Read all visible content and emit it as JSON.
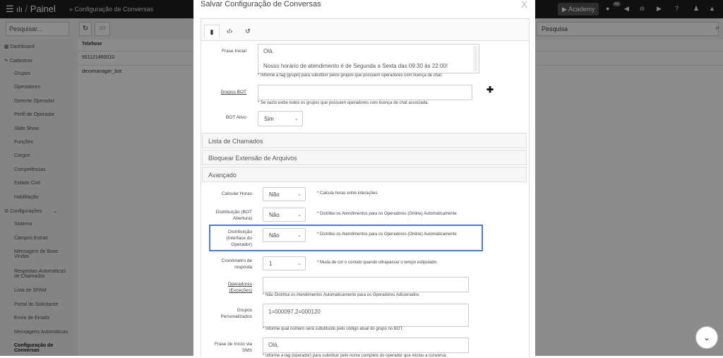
{
  "topbar": {
    "menu_icon": "menu-icon",
    "logo_icon": "bars-logo-icon",
    "separator": "/",
    "app_name": "Painel",
    "breadcrumb": "» Configuração de Conversas",
    "academy_label": "Academy",
    "academy_icon": "youtube-icon",
    "badge": "48"
  },
  "toolbar": {
    "search_placeholder": "Pesquisar...",
    "refresh_icon": "refresh-icon",
    "pager": "2/2",
    "right_search": "Pesquisa"
  },
  "sidebar": {
    "items": [
      {
        "label": "Dashboard"
      },
      {
        "label": "Cadastros"
      },
      {
        "label": "Grupos"
      },
      {
        "label": "Operadores"
      },
      {
        "label": "Gerente Operador"
      },
      {
        "label": "Perfil de Operador"
      },
      {
        "label": "Slide Show"
      },
      {
        "label": "Funções"
      },
      {
        "label": "Cargos"
      },
      {
        "label": "Competências"
      },
      {
        "label": "Estado Civil"
      },
      {
        "label": "Habilitação"
      },
      {
        "label": "Configurações"
      },
      {
        "label": "Sistema"
      },
      {
        "label": "Campos Extras"
      },
      {
        "label": "Mensagem de Boas Vindas"
      },
      {
        "label": "Respostas Automáticas de Chamados"
      },
      {
        "label": "Lista de SPAM"
      },
      {
        "label": "Portal do Solicitante"
      },
      {
        "label": "Envio de Emails"
      },
      {
        "label": "Mensagens Automáticas"
      },
      {
        "label": "Configuração de Conversas"
      }
    ]
  },
  "table": {
    "header": "Telefone",
    "rows": [
      "551121460010",
      "dexxmanager_bot"
    ]
  },
  "modal": {
    "title": "Salvar Configuração de Conversas",
    "close": "X",
    "tabs": [
      {
        "icon": "document-icon"
      },
      {
        "icon": "code-icon"
      },
      {
        "icon": "history-icon"
      }
    ],
    "frase_inicial": {
      "label": "Frase Inicial",
      "line1": "Olá.",
      "line2": "Nosso horário de atendimento é de Segunda a Sexta das 09:30 às 22:00!",
      "hint": "* Informe a tag {grupo} para substituir pelos grupos que possuem operadores com licença de chat."
    },
    "grupos_bot": {
      "label": "Grupos BOT",
      "value": "",
      "hint": "* Se vazio exibe todos os grupos que possuem operadores com licença de chat associada."
    },
    "bot_ativo": {
      "label": "BOT Ativo",
      "value": "Sim"
    },
    "sections": {
      "lista_chamados": "Lista de Chamados",
      "bloquear": "Bloquear Extensão de Arquivos",
      "avancado": "Avançado"
    },
    "calcular_horas": {
      "label": "Calcular Horas",
      "value": "Não",
      "hint": "* Calcula horas entre interações"
    },
    "dist_bot": {
      "label1": "Distribuição (BOT",
      "label2": "Abertura)",
      "value": "Não",
      "hint": "* Distribui os Atendimentos para os Operadores (Online) Automaticamente"
    },
    "dist_interface": {
      "label1": "Distribuição",
      "label2": "(Interface do",
      "label3": "Operador)",
      "value": "Não",
      "hint": "* Distribui os Atendimentos para os Operadores (Online) Automaticamente"
    },
    "cronometro": {
      "label1": "Cronômetro de",
      "label2": "resposta",
      "value": "1",
      "hint": "* Muda de cor o contato quando ultrapassar o tempo estipulado."
    },
    "operadores": {
      "label1": "Operadores",
      "label2": "(Exceções)",
      "value": "",
      "hint": "* Não Distribui os Atendimentos Automaticamente para os Operadores Adicionados"
    },
    "grupos_personalizados": {
      "label1": "Grupos",
      "label2": "Personalizados",
      "value": "1=000097,2=000120",
      "hint": "* Informe qual número será substituído pelo código atual do grupo no BOT."
    },
    "frase_sms": {
      "label1": "Frase de Início via",
      "label2": "SMS",
      "value": "Olá,",
      "hint": "* Informe a tag {operador} para substituir pelo nome completo do operador que iniciou a conversa."
    }
  }
}
